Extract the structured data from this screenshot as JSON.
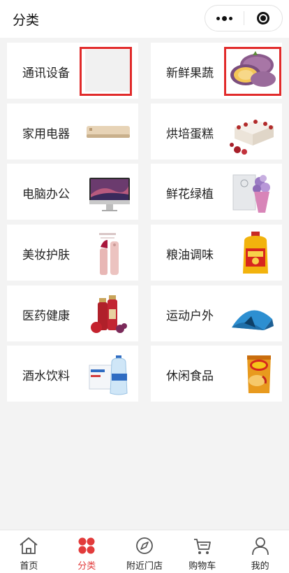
{
  "header": {
    "title": "分类"
  },
  "categories": [
    {
      "label": "通讯设备",
      "image": "placeholder-blank"
    },
    {
      "label": "新鲜果蔬",
      "image": "fruit-image"
    },
    {
      "label": "家用电器",
      "image": "air-conditioner-image"
    },
    {
      "label": "烘培蛋糕",
      "image": "cake-image"
    },
    {
      "label": "电脑办公",
      "image": "imac-image"
    },
    {
      "label": "鲜花绿植",
      "image": "flower-bouquet-image"
    },
    {
      "label": "美妆护肤",
      "image": "lipstick-image"
    },
    {
      "label": "粮油调味",
      "image": "cooking-oil-image"
    },
    {
      "label": "医药健康",
      "image": "health-drink-image"
    },
    {
      "label": "运动户外",
      "image": "tent-image"
    },
    {
      "label": "酒水饮料",
      "image": "water-bottle-image"
    },
    {
      "label": "休闲食品",
      "image": "chips-image"
    }
  ],
  "tabbar": [
    {
      "label": "首页",
      "icon": "home-icon",
      "active": false
    },
    {
      "label": "分类",
      "icon": "category-icon",
      "active": true
    },
    {
      "label": "附近门店",
      "icon": "compass-icon",
      "active": false
    },
    {
      "label": "购物车",
      "icon": "cart-icon",
      "active": false
    },
    {
      "label": "我的",
      "icon": "user-icon",
      "active": false
    }
  ],
  "colors": {
    "accent": "#e23b3b",
    "highlight_box": "#e12b2b",
    "background": "#f3f3f3"
  }
}
